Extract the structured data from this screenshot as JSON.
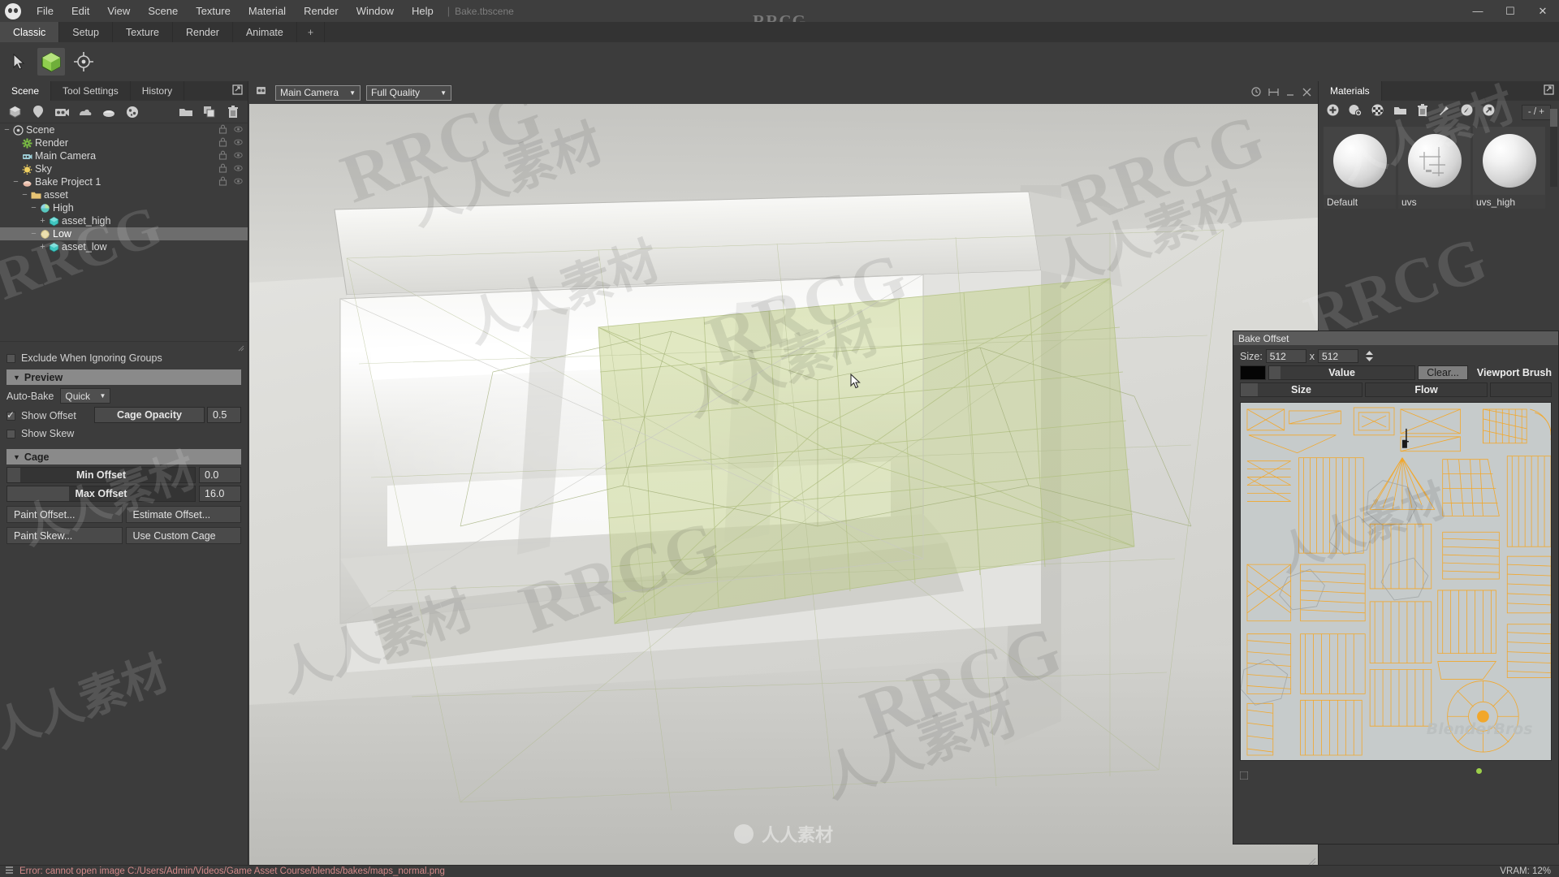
{
  "app": {
    "title": "Bake.tbscene",
    "center_watermark": "RRCG",
    "bottom_watermark": "人人素材"
  },
  "menubar": {
    "logo_icon": "marmoset-logo-icon",
    "items": [
      "File",
      "Edit",
      "View",
      "Scene",
      "Texture",
      "Material",
      "Render",
      "Window",
      "Help"
    ],
    "separator": "|",
    "window_controls": {
      "minimize": "minimize-icon",
      "maximize": "maximize-icon",
      "close": "close-icon"
    }
  },
  "layout_tabs": {
    "items": [
      "Classic",
      "Setup",
      "Texture",
      "Render",
      "Animate"
    ],
    "active": "Classic",
    "add_label": "+"
  },
  "toolrow": {
    "tools": [
      "select-arrow-icon",
      "object-cube-icon",
      "transform-gizmo-icon"
    ],
    "active_index": 1
  },
  "left_panel": {
    "tabs": [
      "Scene",
      "Tool Settings",
      "History"
    ],
    "active_tab": "Scene",
    "popout_icon": "popout-icon",
    "scene_toolbar_icons": [
      "add-mesh-icon",
      "add-light-icon",
      "add-camera-icon",
      "add-sky-icon",
      "add-bakeproject-icon",
      "add-texture-icon",
      "new-folder-icon",
      "duplicate-icon",
      "delete-icon"
    ],
    "outliner": [
      {
        "label": "Scene",
        "depth": 0,
        "expander": "−",
        "icon": "scene-icon",
        "selected": false
      },
      {
        "label": "Render",
        "depth": 1,
        "expander": "",
        "icon": "render-gear-icon",
        "selected": false
      },
      {
        "label": "Main Camera",
        "depth": 1,
        "expander": "",
        "icon": "camera-icon",
        "selected": false
      },
      {
        "label": "Sky",
        "depth": 1,
        "expander": "",
        "icon": "sky-icon",
        "selected": false
      },
      {
        "label": "Bake Project 1",
        "depth": 1,
        "expander": "−",
        "icon": "bakeproject-icon",
        "selected": false
      },
      {
        "label": "asset",
        "depth": 2,
        "expander": "−",
        "icon": "folder-icon",
        "selected": false
      },
      {
        "label": "High",
        "depth": 3,
        "expander": "−",
        "icon": "high-group-icon",
        "selected": false
      },
      {
        "label": "asset_high",
        "depth": 4,
        "expander": "+",
        "icon": "mesh-cube-icon",
        "selected": false
      },
      {
        "label": "Low",
        "depth": 3,
        "expander": "−",
        "icon": "low-group-icon",
        "selected": true
      },
      {
        "label": "asset_low",
        "depth": 4,
        "expander": "+",
        "icon": "mesh-cube-icon",
        "selected": false
      }
    ],
    "row_icons": {
      "lock": "lock-icon",
      "visibility": "eye-icon"
    },
    "exclude_checkbox": {
      "label": "Exclude When Ignoring Groups",
      "checked": false
    },
    "preview_section": {
      "title": "Preview",
      "auto_bake_label": "Auto-Bake",
      "auto_bake_value": "Quick",
      "show_offset": {
        "label": "Show Offset",
        "checked": true
      },
      "show_skew": {
        "label": "Show Skew",
        "checked": false
      },
      "cage_opacity_label": "Cage Opacity",
      "cage_opacity_value": "0.5"
    },
    "cage_section": {
      "title": "Cage",
      "min_offset_label": "Min Offset",
      "min_offset_value": "0.0",
      "min_offset_fill_pct": 7,
      "max_offset_label": "Max Offset",
      "max_offset_value": "16.0",
      "max_offset_fill_pct": 33,
      "buttons": [
        "Paint Offset...",
        "Estimate Offset...",
        "Paint Skew...",
        "Use Custom Cage"
      ]
    }
  },
  "viewport": {
    "expand_icon": "viewport-expand-icon",
    "camera_icon": "camera-small-icon",
    "camera_value": "Main Camera",
    "quality_value": "Full Quality",
    "right_icons": [
      "stats-icon",
      "grid-icon",
      "minimize-viewport-icon",
      "close-viewport-icon"
    ],
    "cursor": "mouse-cursor"
  },
  "materials_panel": {
    "tab_label": "Materials",
    "popout_icon": "popout-icon",
    "toolbar_icons": [
      "add-material-icon",
      "duplicate-material-icon",
      "checker-material-icon",
      "material-folder-icon",
      "delete-material-icon",
      "pick-material-icon",
      "assign-material-icon",
      "export-material-icon"
    ],
    "ratio_value": "- / +",
    "materials": [
      {
        "name": "Default",
        "thumb": "sphere-default"
      },
      {
        "name": "uvs",
        "thumb": "sphere-uvs"
      },
      {
        "name": "uvs_high",
        "thumb": "sphere-uvs-high"
      }
    ]
  },
  "bake_offset_panel": {
    "title": "Bake Offset",
    "size_label": "Size:",
    "size_width": "512",
    "size_x": "x",
    "size_height": "512",
    "spinner_icon": "spinner-up-down-icon",
    "color_swatch": "#050505",
    "value_label": "Value",
    "value_fill_pct": 8,
    "clear_button": "Clear...",
    "viewport_brush_label": "Viewport Brush",
    "size_slider_label": "Size",
    "size_slider_fill_pct": 14,
    "flow_slider_label": "Flow",
    "flow_slider_fill_pct": 0,
    "uv_preview": "uv-layout-preview",
    "uv_watermark": "BlenderBros",
    "resize_icon": "resize-grip-icon",
    "status_dot_color": "#9ccf4a"
  },
  "statusbar": {
    "menu_icon": "status-menu-icon",
    "message": "Error: cannot open image C:/Users/Admin/Videos/Game Asset Course/blends/bakes/maps_normal.png",
    "vram": "VRAM: 12%"
  },
  "watermarks": {
    "text_latin": "RRCG",
    "text_cn": "人人素材"
  }
}
